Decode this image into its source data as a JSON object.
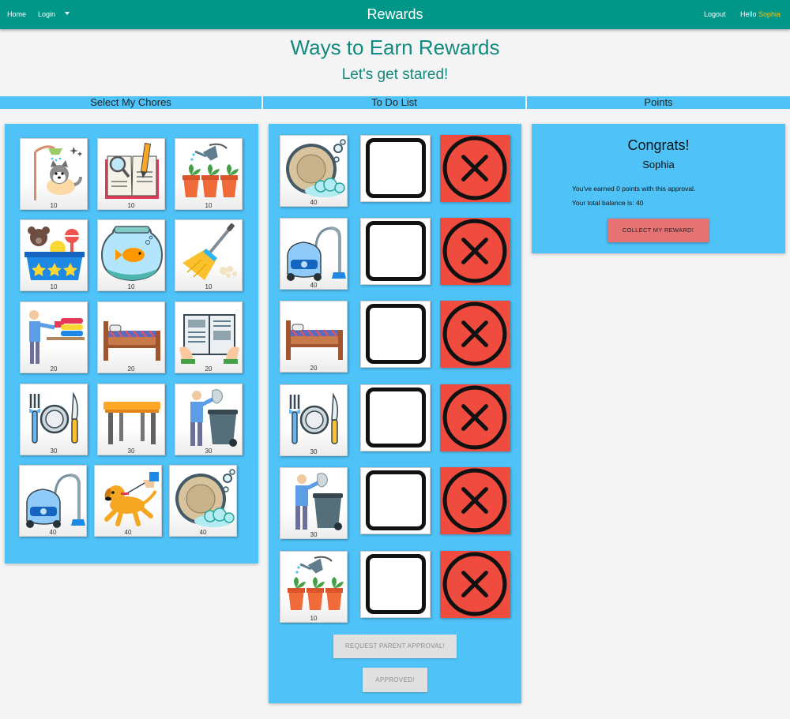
{
  "navbar": {
    "home": "Home",
    "login": "Login",
    "brand": "Rewards",
    "logout": "Logout",
    "hello": "Hello",
    "user": "Sophia",
    "color": "#009688"
  },
  "page": {
    "title": "Ways to Earn Rewards",
    "subtitle": "Let's get stared!"
  },
  "columns": {
    "select": "Select My Chores",
    "todo": "To Do List",
    "points": "Points"
  },
  "chores": [
    {
      "icon": "dog-bath-icon",
      "points": "10"
    },
    {
      "icon": "homework-icon",
      "points": "10"
    },
    {
      "icon": "water-plants-icon",
      "points": "10"
    },
    {
      "icon": "toy-box-icon",
      "points": "10"
    },
    {
      "icon": "fish-bowl-icon",
      "points": "10"
    },
    {
      "icon": "broom-icon",
      "points": "10"
    },
    {
      "icon": "laundry-icon",
      "points": "20"
    },
    {
      "icon": "make-bed-icon",
      "points": "20"
    },
    {
      "icon": "reading-icon",
      "points": "20"
    },
    {
      "icon": "set-table-icon",
      "points": "30"
    },
    {
      "icon": "table-icon",
      "points": "30"
    },
    {
      "icon": "trash-icon",
      "points": "30"
    },
    {
      "icon": "vacuum-icon",
      "points": "40"
    },
    {
      "icon": "walk-dog-icon",
      "points": "40"
    },
    {
      "icon": "dishes-icon",
      "points": "40"
    }
  ],
  "todo": [
    {
      "icon": "dishes-icon",
      "points": "40"
    },
    {
      "icon": "vacuum-icon",
      "points": "40"
    },
    {
      "icon": "make-bed-icon",
      "points": "20"
    },
    {
      "icon": "set-table-icon",
      "points": "30"
    },
    {
      "icon": "trash-icon",
      "points": "30"
    },
    {
      "icon": "water-plants-icon",
      "points": "10"
    }
  ],
  "buttons": {
    "request": "REQUEST PARENT APPROVAL!",
    "approved": "APPROVED!",
    "collect": "COLLECT MY REWARD!"
  },
  "points_panel": {
    "congrats": "Congrats!",
    "name": "Sophia",
    "earned": "You've earned 0 points with this approval.",
    "balance": "Your total balance is: 40"
  },
  "colors": {
    "panel": "#4fc3f7",
    "title": "#13897f",
    "remove": "#ef4b3f",
    "collect": "#e57373"
  }
}
